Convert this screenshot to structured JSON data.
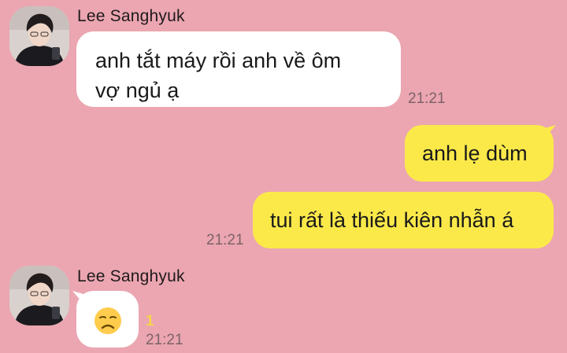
{
  "colors": {
    "background": "#eba6b1",
    "incoming_bubble": "#ffffff",
    "outgoing_bubble": "#fbe94a",
    "timestamp": "#7d6268",
    "unread_badge": "#f6d54a"
  },
  "messages": [
    {
      "direction": "incoming",
      "sender": "Lee Sanghyuk",
      "text_line1": "anh tắt máy rồi anh về ôm",
      "text_line2": "vợ ngủ ạ",
      "time": "21:21"
    },
    {
      "direction": "outgoing",
      "text": "anh lẹ dùm"
    },
    {
      "direction": "outgoing",
      "text": "tui rất là thiếu kiên nhẫn á",
      "time": "21:21"
    },
    {
      "direction": "incoming",
      "sender": "Lee Sanghyuk",
      "emoji": "disappointed-face-emoji",
      "unread_count": "1",
      "time": "21:21"
    }
  ]
}
